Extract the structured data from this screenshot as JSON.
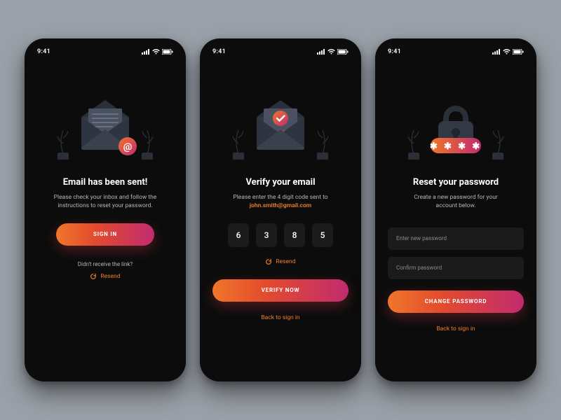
{
  "status": {
    "time": "9:41"
  },
  "screens": [
    {
      "title": "Email has been sent!",
      "desc_line1": "Please check your inbox and follow the",
      "desc_line2": "instructions to reset your password.",
      "cta": "SIGN IN",
      "hint": "Didn't receive the link?",
      "resend": "Resend"
    },
    {
      "title": "Verify your email",
      "desc_prefix": "Please enter the 4 digit code sent to",
      "email": "john.smith@gmail.com",
      "otp": [
        "6",
        "3",
        "8",
        "5"
      ],
      "resend": "Resend",
      "cta": "VERIFY NOW",
      "back": "Back to sign in"
    },
    {
      "title": "Reset your password",
      "desc_line1": "Create a new password for your",
      "desc_line2": "account below.",
      "input_new": "Enter new password",
      "input_confirm": "Confirm password",
      "cta": "CHANGE PASSWORD",
      "back": "Back to sign in"
    }
  ],
  "colors": {
    "accent": "#f07f2f",
    "gradient_from": "#f0762a",
    "gradient_to": "#c12b6f"
  }
}
